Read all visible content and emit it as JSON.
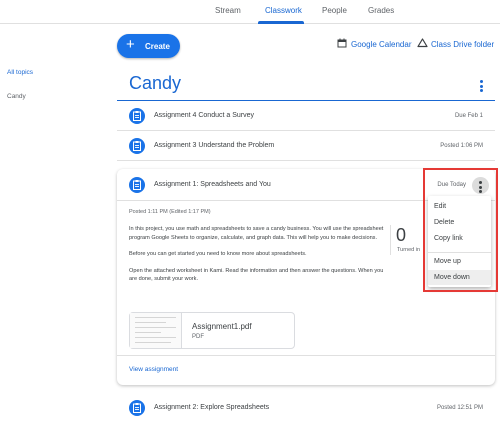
{
  "nav": {
    "tabs": [
      {
        "label": "Stream"
      },
      {
        "label": "Classwork"
      },
      {
        "label": "People"
      },
      {
        "label": "Grades"
      }
    ],
    "active_tab": "Classwork"
  },
  "toolbar": {
    "create_label": "Create",
    "calendar_label": "Google Calendar",
    "drive_label": "Class Drive folder"
  },
  "sidebar": {
    "items": [
      {
        "label": "All topics"
      },
      {
        "label": "Candy"
      }
    ]
  },
  "topic": {
    "title": "Candy"
  },
  "assignments": [
    {
      "title": "Assignment 4 Conduct a Survey",
      "meta": "Due Feb 1"
    },
    {
      "title": "Assignment 3 Understand the Problem",
      "meta": "Posted 1:06 PM"
    }
  ],
  "expanded": {
    "title": "Assignment 1: Spreadsheets and You",
    "due": "Due Today",
    "posted": "Posted 1:11 PM (Edited 1:17 PM)",
    "description": [
      "In this project, you use math and spreadsheets to save a candy business. You will use the spreadsheet program Google Sheets to organize, calculate, and graph data. This will help you to make decisions.",
      "Before you can get started you need to know more about spreadsheets.",
      "Open the attached worksheet in Kami. Read the information and then answer the questions. When you are done, submit your work."
    ],
    "turned_in_count": "0",
    "turned_in_label": "Turned in",
    "attachment": {
      "name": "Assignment1.pdf",
      "type": "PDF"
    },
    "view_label": "View assignment"
  },
  "menu": {
    "items": [
      {
        "label": "Edit"
      },
      {
        "label": "Delete"
      },
      {
        "label": "Copy link"
      },
      {
        "label": "Move up"
      },
      {
        "label": "Move down"
      }
    ],
    "hovered": "Move down"
  },
  "last_assignment": {
    "title": "Assignment 2: Explore Spreadsheets",
    "meta": "Posted 12:51 PM"
  },
  "colors": {
    "accent": "#1967d2",
    "button": "#1a73e8",
    "highlight": "#e53935"
  }
}
